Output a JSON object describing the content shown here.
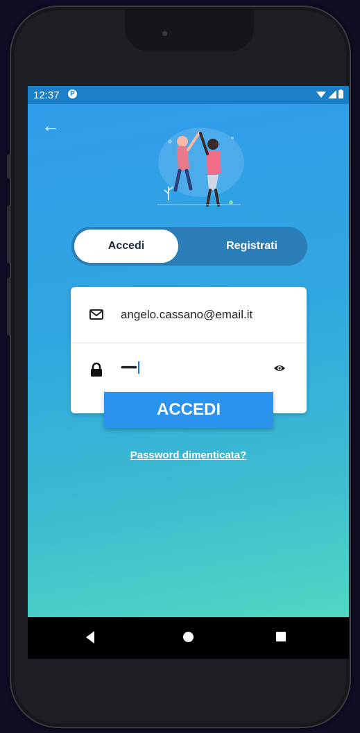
{
  "status_bar": {
    "time": "12:37",
    "app_icon": "app-notification-icon",
    "icons": [
      "wifi-icon",
      "signal-icon",
      "battery-icon"
    ]
  },
  "header": {
    "back_icon": "back-arrow-icon",
    "illustration": "high-five-illustration"
  },
  "auth_toggle": {
    "login_label": "Accedi",
    "register_label": "Registrati",
    "selected": "Accedi"
  },
  "form": {
    "email_icon": "mail-icon",
    "email_value": "angelo.cassano@email.it",
    "password_icon": "lock-icon",
    "password_value": "•••••••••••",
    "visibility_icon": "eye-icon",
    "submit_label": "ACCEDI"
  },
  "forgot_password": "Password dimenticata?",
  "nav_bar": {
    "back": "nav-back-icon",
    "home": "nav-home-icon",
    "recents": "nav-recents-icon"
  },
  "colors": {
    "accent": "#2b93ee",
    "status_bar": "#1b7fc8",
    "gradient_top": "#2f9bea",
    "gradient_bottom": "#50d8c3",
    "toggle_bg": "#2a7db7"
  }
}
